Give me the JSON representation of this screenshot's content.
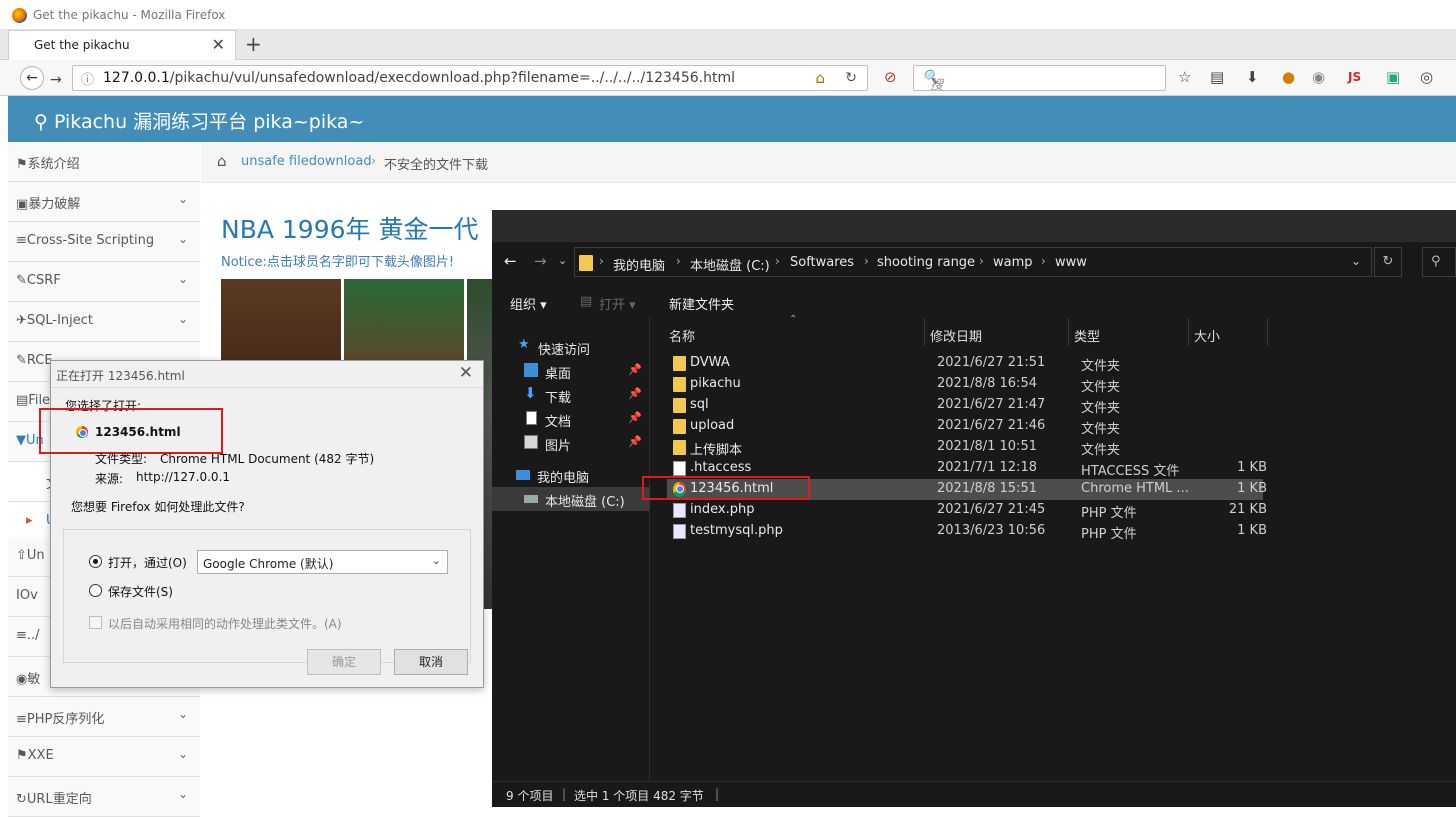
{
  "window": {
    "title": "Get the pikachu - Mozilla Firefox"
  },
  "tab": {
    "label": "Get the pikachu",
    "close": "✕",
    "new": "+"
  },
  "nav": {
    "url_host": "127.0.0.1",
    "url_path": "/pikachu/vul/unsafedownload/execdownload.php?filename=../../../../123456.html",
    "search_placeholder": "搜索",
    "js_label": "JS"
  },
  "page": {
    "brand": "Pikachu 漏洞练习平台 pika~pika~",
    "breadcrumb_link": "unsafe filedownload",
    "breadcrumb_sep": "›",
    "breadcrumb_current": "不安全的文件下载",
    "heading": "NBA 1996年 黄金一代",
    "notice": "Notice:点击球员名字即可下载头像图片!",
    "sidebar": [
      {
        "label": "系统介绍",
        "icon": "tag-icon"
      },
      {
        "label": "暴力破解",
        "icon": "lock-icon"
      },
      {
        "label": "Cross-Site Scripting",
        "icon": "list-icon"
      },
      {
        "label": "CSRF",
        "icon": "edit-icon"
      },
      {
        "label": "SQL-Inject",
        "icon": "plane-icon"
      },
      {
        "label": "RCE",
        "icon": "pencil-icon"
      },
      {
        "label": "File",
        "icon": "file-icon"
      },
      {
        "label": "Un",
        "icon": "download-icon"
      },
      {
        "label": "文",
        "icon": "dot"
      },
      {
        "label": "U",
        "icon": "dot"
      },
      {
        "label": "Un",
        "icon": "upload-icon"
      },
      {
        "label": "Ov",
        "icon": "text-icon"
      },
      {
        "label": "../",
        "icon": "align-icon"
      },
      {
        "label": "敏",
        "icon": "camera-icon"
      },
      {
        "label": "PHP反序列化",
        "icon": "list-icon"
      },
      {
        "label": "XXE",
        "icon": "flag-icon"
      },
      {
        "label": "URL重定向",
        "icon": "refresh-icon"
      }
    ]
  },
  "dialog": {
    "title": "正在打开 123456.html",
    "you_chose": "您选择了打开:",
    "filename": "123456.html",
    "type_label": "文件类型:",
    "type_value": "Chrome HTML Document (482 字节)",
    "source_label": "来源:",
    "source_value": "http://127.0.0.1",
    "question": "您想要 Firefox 如何处理此文件?",
    "open_with": "打开，通过(O)",
    "open_with_app": "Google Chrome (默认)",
    "save_file": "保存文件(S)",
    "auto_action": "以后自动采用相同的动作处理此类文件。(A)",
    "ok": "确定",
    "cancel": "取消"
  },
  "explorer": {
    "path": [
      "我的电脑",
      "本地磁盘 (C:)",
      "Softwares",
      "shooting range",
      "wamp",
      "www"
    ],
    "cmd": {
      "organize": "组织 ▾",
      "open": "打开 ▾",
      "new_folder": "新建文件夹"
    },
    "nav": [
      {
        "label": "快速访问",
        "kind": "star"
      },
      {
        "label": "桌面",
        "kind": "desktop",
        "pinned": true
      },
      {
        "label": "下载",
        "kind": "down",
        "pinned": true
      },
      {
        "label": "文档",
        "kind": "doc",
        "pinned": true
      },
      {
        "label": "图片",
        "kind": "pic",
        "pinned": true
      },
      {
        "label": "我的电脑",
        "kind": "pc"
      },
      {
        "label": "本地磁盘 (C:)",
        "kind": "drive"
      }
    ],
    "columns": {
      "name": "名称",
      "date": "修改日期",
      "type": "类型",
      "size": "大小"
    },
    "files": [
      {
        "name": "DVWA",
        "date": "2021/6/27 21:51",
        "type": "文件夹",
        "size": "",
        "kind": "folder"
      },
      {
        "name": "pikachu",
        "date": "2021/8/8 16:54",
        "type": "文件夹",
        "size": "",
        "kind": "folder"
      },
      {
        "name": "sql",
        "date": "2021/6/27 21:47",
        "type": "文件夹",
        "size": "",
        "kind": "folder"
      },
      {
        "name": "upload",
        "date": "2021/6/27 21:46",
        "type": "文件夹",
        "size": "",
        "kind": "folder"
      },
      {
        "name": "上传脚本",
        "date": "2021/8/1 10:51",
        "type": "文件夹",
        "size": "",
        "kind": "folder"
      },
      {
        "name": ".htaccess",
        "date": "2021/7/1 12:18",
        "type": "HTACCESS 文件",
        "size": "1 KB",
        "kind": "file"
      },
      {
        "name": "123456.html",
        "date": "2021/8/8 15:51",
        "type": "Chrome HTML ...",
        "size": "1 KB",
        "kind": "chrome"
      },
      {
        "name": "index.php",
        "date": "2021/6/27 21:45",
        "type": "PHP 文件",
        "size": "21 KB",
        "kind": "php"
      },
      {
        "name": "testmysql.php",
        "date": "2013/6/23 10:56",
        "type": "PHP 文件",
        "size": "1 KB",
        "kind": "php"
      }
    ],
    "status": {
      "count": "9 个项目",
      "selected": "选中 1 个项目  482 字节"
    }
  }
}
